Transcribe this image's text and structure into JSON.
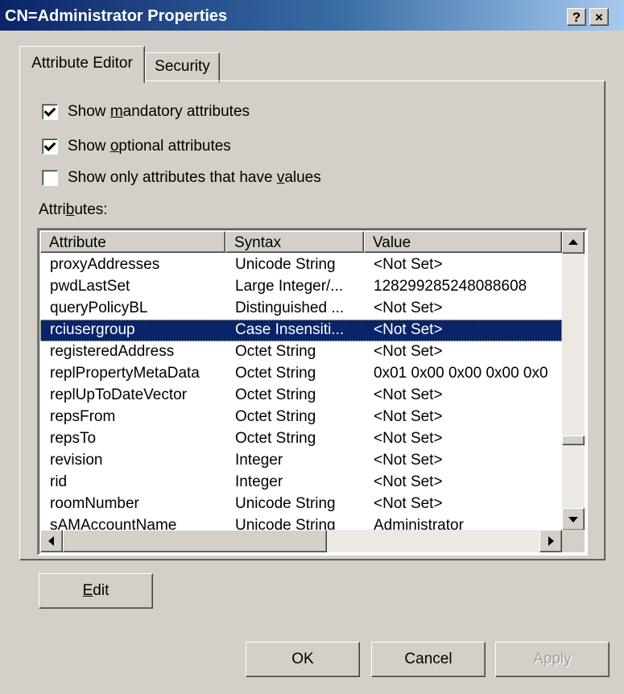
{
  "window": {
    "title": "CN=Administrator Properties",
    "help_label": "?",
    "close_label": "×"
  },
  "tabs": [
    {
      "label": "Attribute Editor",
      "active": true
    },
    {
      "label": "Security",
      "active": false
    }
  ],
  "options": {
    "mandatory": {
      "pre": "Show ",
      "key": "m",
      "post": "andatory attributes",
      "checked": true
    },
    "optional": {
      "pre": "Show ",
      "key": "o",
      "post": "ptional attributes",
      "checked": true
    },
    "with_values": {
      "pre": "Show only attributes that have ",
      "key": "v",
      "post": "alues",
      "checked": false
    }
  },
  "attributes_label": {
    "pre": "Attri",
    "key": "b",
    "post": "utes:"
  },
  "table": {
    "columns": [
      "Attribute",
      "Syntax",
      "Value"
    ],
    "rows": [
      {
        "attribute": "proxyAddresses",
        "syntax": "Unicode String",
        "value": "<Not Set>"
      },
      {
        "attribute": "pwdLastSet",
        "syntax": "Large Integer/...",
        "value": "128299285248088608"
      },
      {
        "attribute": "queryPolicyBL",
        "syntax": "Distinguished ...",
        "value": "<Not Set>"
      },
      {
        "attribute": "rciusergroup",
        "syntax": "Case Insensiti...",
        "value": "<Not Set>",
        "selected": true
      },
      {
        "attribute": "registeredAddress",
        "syntax": "Octet String",
        "value": "<Not Set>"
      },
      {
        "attribute": "replPropertyMetaData",
        "syntax": "Octet String",
        "value": "0x01 0x00 0x00 0x00 0x0"
      },
      {
        "attribute": "replUpToDateVector",
        "syntax": "Octet String",
        "value": "<Not Set>"
      },
      {
        "attribute": "repsFrom",
        "syntax": "Octet String",
        "value": "<Not Set>"
      },
      {
        "attribute": "repsTo",
        "syntax": "Octet String",
        "value": "<Not Set>"
      },
      {
        "attribute": "revision",
        "syntax": "Integer",
        "value": "<Not Set>"
      },
      {
        "attribute": "rid",
        "syntax": "Integer",
        "value": "<Not Set>"
      },
      {
        "attribute": "roomNumber",
        "syntax": "Unicode String",
        "value": "<Not Set>"
      },
      {
        "attribute": "sAMAccountName",
        "syntax": "Unicode String",
        "value": "Administrator"
      }
    ]
  },
  "edit_button": {
    "key": "E",
    "post": "dit"
  },
  "buttons": {
    "ok": "OK",
    "cancel": "Cancel",
    "apply": "Apply"
  },
  "colors": {
    "selection": "#0a246a",
    "face": "#d4d0c8",
    "title_start": "#0a246a",
    "title_end": "#a6caf0"
  }
}
